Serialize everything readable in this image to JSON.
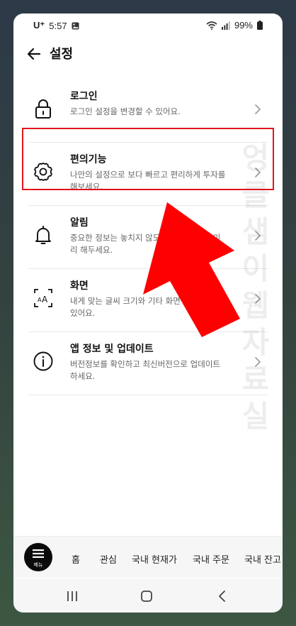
{
  "status": {
    "carrier": "U⁺",
    "time": "5:57",
    "battery": "99%"
  },
  "header": {
    "title": "설정"
  },
  "items": [
    {
      "title": "로그인",
      "desc": "로그인 설정을 변경할 수 있어요."
    },
    {
      "title": "편의기능",
      "desc": "나만의 설정으로 보다 빠르고 편리하게 투자를 해보세요."
    },
    {
      "title": "알림",
      "desc": "중요한 정보는 놓치지 않도록 알림 설정을 미리 해두세요."
    },
    {
      "title": "화면",
      "desc": "내게 맞는 글씨 크기와 기타 화면 설정을 할 수 있어요."
    },
    {
      "title": "앱 정보 및 업데이트",
      "desc": "버전정보를 확인하고 최신버전으로 업데이트 하세요."
    }
  ],
  "watermark": "엉클샘이웹자료실",
  "bottom": {
    "menu_label": "메뉴",
    "tabs": [
      "홈",
      "관심",
      "국내 현재가",
      "국내 주문",
      "국내 잔고"
    ]
  },
  "colors": {
    "highlight": "#e0141e",
    "arrow": "#ff0000"
  }
}
